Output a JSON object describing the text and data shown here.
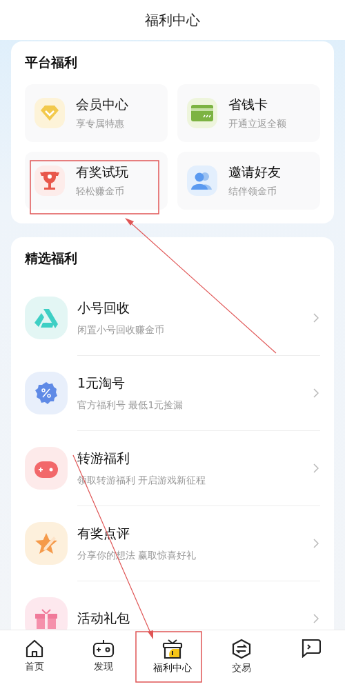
{
  "header": {
    "title": "福利中心"
  },
  "platform": {
    "title": "平台福利",
    "items": [
      {
        "kind": "diamond",
        "title": "会员中心",
        "subtitle": "享专属特惠"
      },
      {
        "kind": "card",
        "title": "省钱卡",
        "subtitle": "开通立返全额"
      },
      {
        "kind": "trophy",
        "title": "有奖试玩",
        "subtitle": "轻松赚金币"
      },
      {
        "kind": "friends",
        "title": "邀请好友",
        "subtitle": "结伴领金币"
      }
    ]
  },
  "featured": {
    "title": "精选福利",
    "items": [
      {
        "kind": "recycle",
        "title": "小号回收",
        "subtitle": "闲置小号回收赚金币"
      },
      {
        "kind": "percent",
        "title": "1元淘号",
        "subtitle": "官方福利号 最低1元捡漏"
      },
      {
        "kind": "gamepad",
        "title": "转游福利",
        "subtitle": "领取转游福利 开启游戏新征程"
      },
      {
        "kind": "star",
        "title": "有奖点评",
        "subtitle": "分享你的想法 赢取惊喜好礼"
      },
      {
        "kind": "gift",
        "title": "活动礼包"
      }
    ]
  },
  "tabs": [
    {
      "kind": "home",
      "label": "首页",
      "selected": false
    },
    {
      "kind": "controller",
      "label": "发现",
      "selected": false
    },
    {
      "kind": "welfare",
      "label": "福利中心",
      "selected": true
    },
    {
      "kind": "trade",
      "label": "交易",
      "selected": false
    },
    {
      "kind": "chat",
      "selected": false
    }
  ]
}
